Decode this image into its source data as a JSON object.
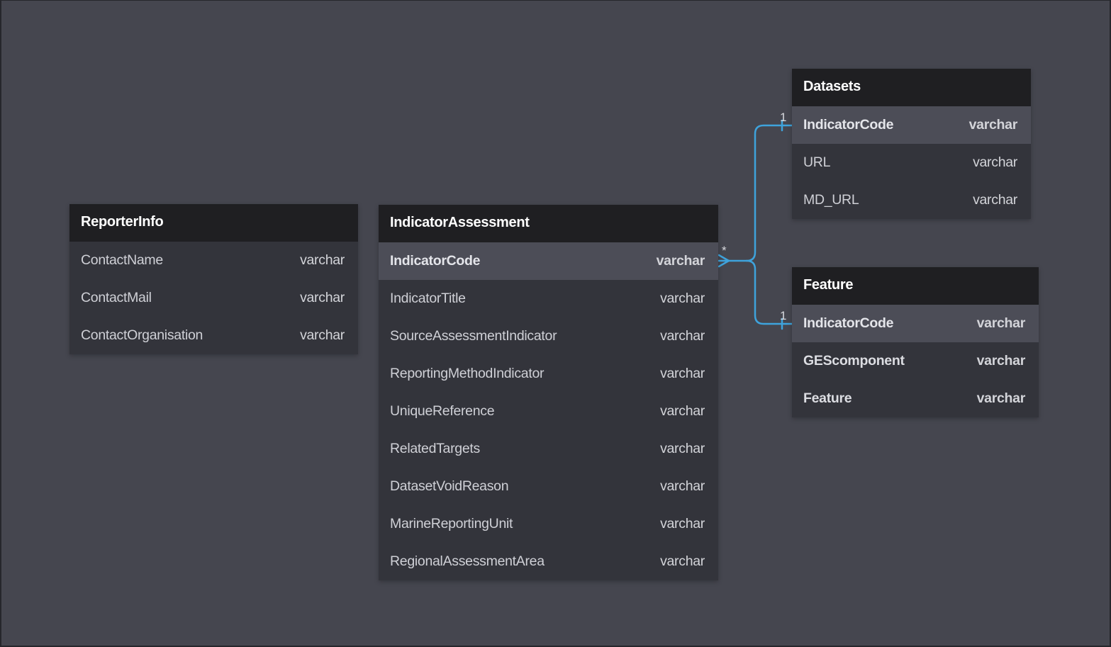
{
  "colors": {
    "link": "#3ea3dc",
    "canvas": "#45464f",
    "header": "#1f1f22"
  },
  "tables": {
    "reporter": {
      "title": "ReporterInfo",
      "fields": [
        {
          "name": "ContactName",
          "type": "varchar"
        },
        {
          "name": "ContactMail",
          "type": "varchar"
        },
        {
          "name": "ContactOrganisation",
          "type": "varchar"
        }
      ]
    },
    "assessment": {
      "title": "IndicatorAssessment",
      "fields": [
        {
          "name": "IndicatorCode",
          "type": "varchar"
        },
        {
          "name": "IndicatorTitle",
          "type": "varchar"
        },
        {
          "name": "SourceAssessmentIndicator",
          "type": "varchar"
        },
        {
          "name": "ReportingMethodIndicator",
          "type": "varchar"
        },
        {
          "name": "UniqueReference",
          "type": "varchar"
        },
        {
          "name": "RelatedTargets",
          "type": "varchar"
        },
        {
          "name": "DatasetVoidReason",
          "type": "varchar"
        },
        {
          "name": "MarineReportingUnit",
          "type": "varchar"
        },
        {
          "name": "RegionalAssessmentArea",
          "type": "varchar"
        }
      ]
    },
    "datasets": {
      "title": "Datasets",
      "fields": [
        {
          "name": "IndicatorCode",
          "type": "varchar"
        },
        {
          "name": "URL",
          "type": "varchar"
        },
        {
          "name": "MD_URL",
          "type": "varchar"
        }
      ]
    },
    "feature": {
      "title": "Feature",
      "fields": [
        {
          "name": "IndicatorCode",
          "type": "varchar"
        },
        {
          "name": "GEScomponent",
          "type": "varchar"
        },
        {
          "name": "Feature",
          "type": "varchar"
        }
      ]
    }
  },
  "relations": {
    "many_label": "*",
    "datasets_one_label": "1",
    "feature_one_label": "1"
  }
}
